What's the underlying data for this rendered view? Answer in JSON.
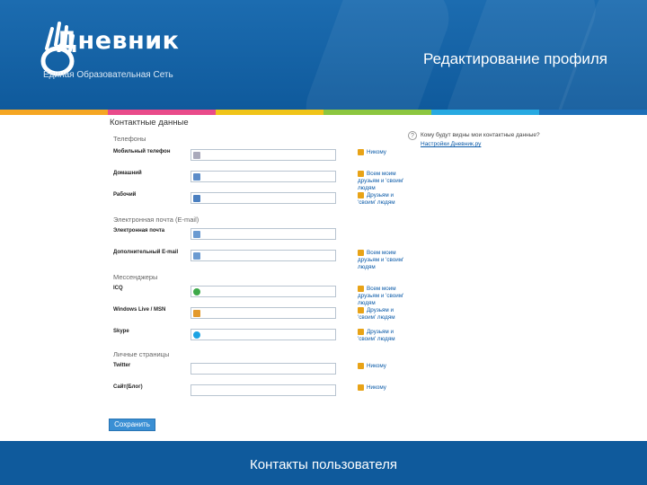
{
  "header": {
    "logo_text": "Дневник",
    "logo_subtitle": "Единая Образовательная Сеть",
    "slide_title": "Редактирование профиля",
    "stripe_colors": [
      "#f5a623",
      "#e94b8a",
      "#f0c419",
      "#8cc63f",
      "#27a9e1",
      "#1d6fb8"
    ]
  },
  "form": {
    "section_title": "Контактные данные",
    "groups": [
      "Телефоны",
      "Электронная почта (E-mail)",
      "Мессенджеры",
      "Личные страницы"
    ],
    "fields": [
      {
        "label": "Мобильный телефон",
        "visibility": "Никому"
      },
      {
        "label": "Домашний",
        "visibility": "Всем моим друзьям и 'своим' людям"
      },
      {
        "label": "Рабочий",
        "visibility": "Друзьям и 'своим' людям"
      },
      {
        "label": "Электронная почта",
        "visibility": ""
      },
      {
        "label": "Дополнительный E-mail",
        "visibility": "Всем моим друзьям и 'своим' людям"
      },
      {
        "label": "ICQ",
        "visibility": "Всем моим друзьям и 'своим' людям"
      },
      {
        "label": "Windows Live / MSN",
        "visibility": "Друзьям и 'своим' людям"
      },
      {
        "label": "Skype",
        "visibility": "Друзьям и 'своим' людям"
      },
      {
        "label": "Twitter",
        "visibility": "Никому"
      },
      {
        "label": "Сайт(Блог)",
        "visibility": "Никому"
      }
    ],
    "save_label": "Сохранить"
  },
  "help": {
    "question": "Кому будут видны мои контактные данные?",
    "link": "Настройки Дневник.ру"
  },
  "footer": {
    "caption": "Контакты пользователя"
  }
}
